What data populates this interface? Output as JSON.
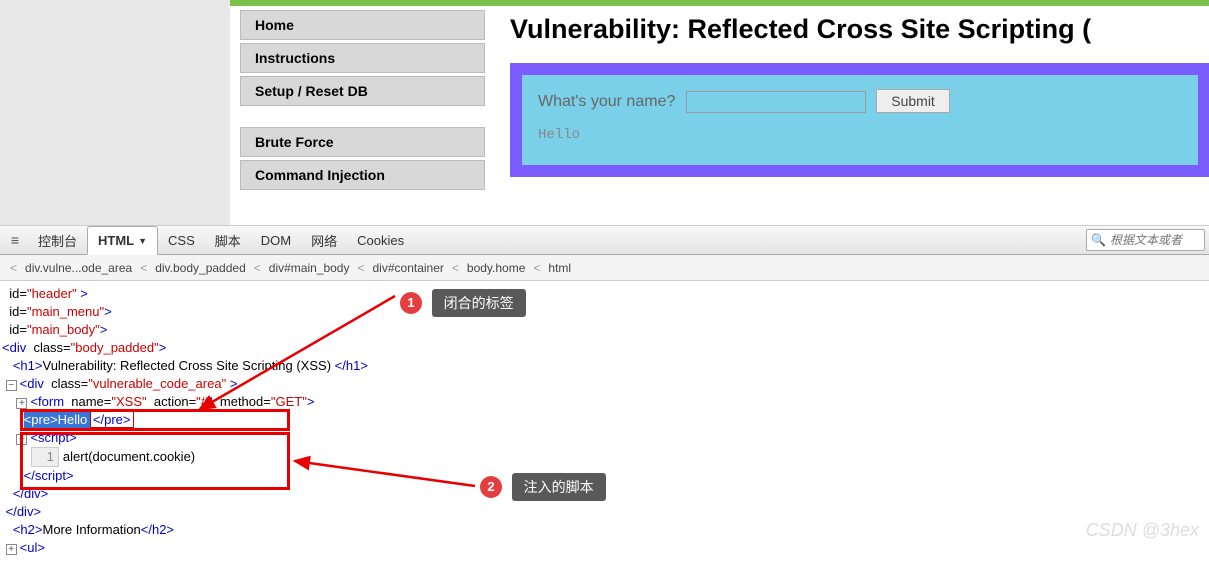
{
  "page": {
    "title": "Vulnerability: Reflected Cross Site Scripting (",
    "menu": [
      "Home",
      "Instructions",
      "Setup / Reset DB",
      "",
      "Brute Force",
      "Command Injection"
    ],
    "form_label": "What's your name?",
    "submit": "Submit",
    "output": "Hello"
  },
  "devtools": {
    "tabs": [
      "控制台",
      "HTML",
      "CSS",
      "脚本",
      "DOM",
      "网络",
      "Cookies"
    ],
    "active_tab": "HTML",
    "search_placeholder": "根据文本或者"
  },
  "breadcrumb": [
    "div.vulne...ode_area",
    "div.body_padded",
    "div#main_body",
    "div#container",
    "body.home",
    "html"
  ],
  "code": {
    "l1_attr": "header",
    "l2_attr": "main_menu",
    "l3_attr": "main_body",
    "l4_cls": "body_padded",
    "l5_t1": "<h1>",
    "l5_txt": "Vulnerability: Reflected Cross Site Scripting (XSS)",
    "l5_t2": "</h1>",
    "l6_cls": "vulnerable_code_area",
    "l7_name": "XSS",
    "l7_action": "#",
    "l7_method": "GET",
    "l8_open": "<pre>",
    "l8_txt": "Hello ",
    "l8_close": "</pre>",
    "l9": "<script>",
    "l10_num": "1",
    "l10_code": "alert(document.cookie)",
    "l11": "</script>",
    "l12": "</div>",
    "l13": "</div>",
    "l14_t1": "<h2>",
    "l14_txt": "More Information",
    "l14_t2": "</h2>",
    "l15": "<ul>"
  },
  "callouts": {
    "c1": "闭合的标签",
    "c2": "注入的脚本"
  },
  "watermark": "CSDN @3hex"
}
